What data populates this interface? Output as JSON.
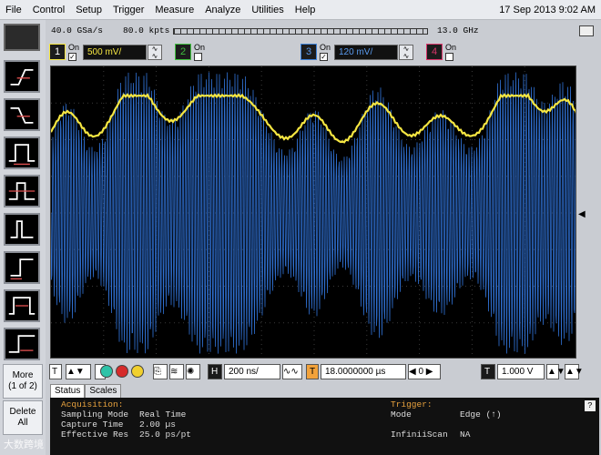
{
  "menu": {
    "items": [
      "File",
      "Control",
      "Setup",
      "Trigger",
      "Measure",
      "Analyze",
      "Utilities",
      "Help"
    ],
    "datetime": "17 Sep 2013  9:02 AM"
  },
  "acquisition_info": {
    "sample_rate": "40.0 GSa/s",
    "points": "80.0 kpts",
    "bandwidth": "13.0 GHz"
  },
  "channels": [
    {
      "num": "1",
      "on_label": "On",
      "enabled": true,
      "scale": "500 mV/",
      "color": "#f5e642"
    },
    {
      "num": "2",
      "on_label": "On",
      "enabled": false,
      "color": "#3fbf3f"
    },
    {
      "num": "3",
      "on_label": "On",
      "enabled": true,
      "scale": "120 mV/",
      "color": "#3b7fd6"
    },
    {
      "num": "4",
      "on_label": "On",
      "enabled": false,
      "color": "#d9366b"
    }
  ],
  "sidebar": {
    "more_label": "More",
    "more_sub": "(1 of 2)",
    "delete_label": "Delete",
    "delete_sub": "All"
  },
  "controls": {
    "horizontal_label": "H",
    "timebase": "200 ns/",
    "trigger_label": "T",
    "delay": "18.0000000 µs",
    "trigger_level_label": "T",
    "trigger_level": "1.000 V"
  },
  "tabs": [
    "Status",
    "Scales"
  ],
  "status": {
    "acquisition_header": "Acquisition:",
    "trigger_header": "Trigger:",
    "rows": [
      {
        "label": "Sampling Mode",
        "value": "Real Time"
      },
      {
        "label": "Capture Time",
        "value": "2.00 µs"
      },
      {
        "label": "Effective Res",
        "value": "25.0 ps/pt"
      }
    ],
    "trigger_rows": [
      {
        "label": "Mode",
        "value": "Edge (↑)"
      },
      {
        "label": "InfiniiScan",
        "value": "NA"
      }
    ],
    "help": "?"
  },
  "watermark": "大数跨境",
  "colors": {
    "ch1_trace": "#f5e642",
    "ch3_trace": "#2f6fd0",
    "grid": "#555555"
  }
}
